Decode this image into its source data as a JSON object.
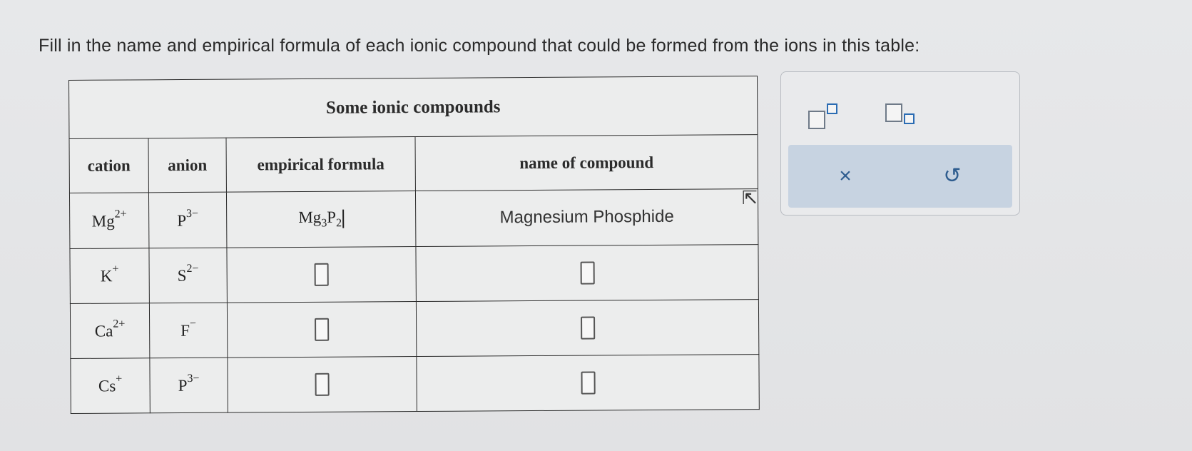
{
  "prompt": "Fill in the name and empirical formula of each ionic compound that could be formed from the ions in this table:",
  "table": {
    "caption": "Some ionic compounds",
    "headers": [
      "cation",
      "anion",
      "empirical formula",
      "name of compound"
    ],
    "rows": [
      {
        "cation": "Mg",
        "cation_charge": "2+",
        "anion": "P",
        "anion_charge": "3−",
        "formula_a": "Mg",
        "formula_a_sub": "3",
        "formula_b": "P",
        "formula_b_sub": "2",
        "name": "Magnesium Phosphide"
      },
      {
        "cation": "K",
        "cation_charge": "+",
        "anion": "S",
        "anion_charge": "2−",
        "name": ""
      },
      {
        "cation": "Ca",
        "cation_charge": "2+",
        "anion": "F",
        "anion_charge": "−",
        "name": ""
      },
      {
        "cation": "Cs",
        "cation_charge": "+",
        "anion": "P",
        "anion_charge": "3−",
        "name": ""
      }
    ]
  },
  "toolbar": {
    "superscript_icon": "superscript-template-icon",
    "subscript_icon": "subscript-template-icon",
    "clear_label": "×",
    "undo_label": "↺"
  }
}
